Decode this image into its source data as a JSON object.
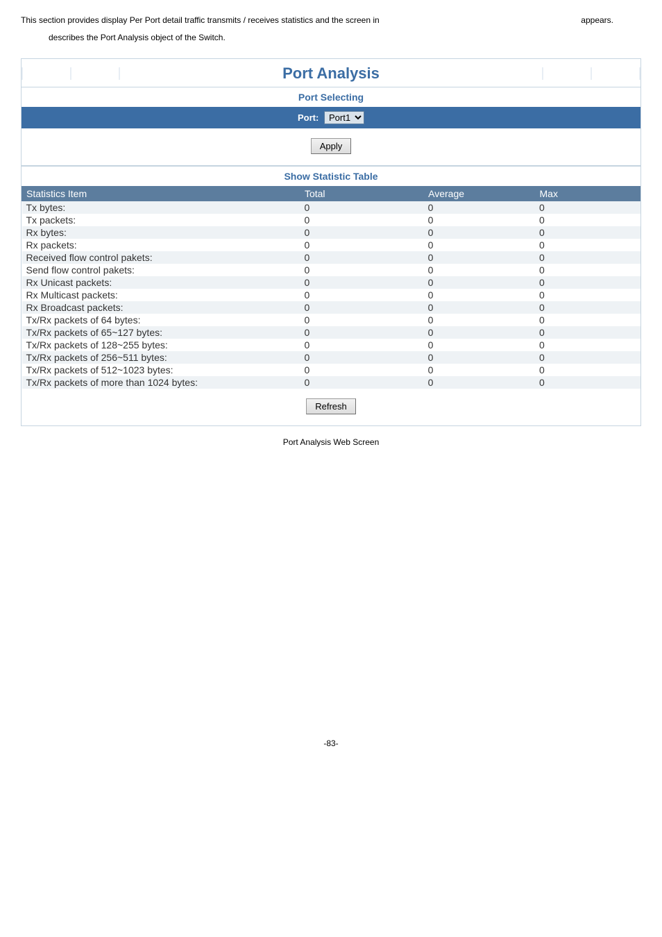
{
  "intro": {
    "line1": "This section provides display Per Port detail traffic transmits / receives statistics and the screen in",
    "appears": "appears.",
    "line2": "describes the Port Analysis object of the Switch."
  },
  "titles": {
    "main": "Port Analysis",
    "port_selecting": "Port Selecting",
    "show_stat": "Show Statistic Table"
  },
  "port": {
    "label": "Port:",
    "selected": "Port1"
  },
  "buttons": {
    "apply": "Apply",
    "refresh": "Refresh"
  },
  "headers": {
    "item": "Statistics Item",
    "total": "Total",
    "avg": "Average",
    "max": "Max"
  },
  "rows": [
    {
      "item": "Tx bytes:",
      "total": "0",
      "avg": "0",
      "max": "0"
    },
    {
      "item": "Tx packets:",
      "total": "0",
      "avg": "0",
      "max": "0"
    },
    {
      "item": "Rx bytes:",
      "total": "0",
      "avg": "0",
      "max": "0"
    },
    {
      "item": "Rx packets:",
      "total": "0",
      "avg": "0",
      "max": "0"
    },
    {
      "item": "Received flow control pakets:",
      "total": "0",
      "avg": "0",
      "max": "0"
    },
    {
      "item": "Send flow control pakets:",
      "total": "0",
      "avg": "0",
      "max": "0"
    },
    {
      "item": "Rx Unicast packets:",
      "total": "0",
      "avg": "0",
      "max": "0"
    },
    {
      "item": "Rx Multicast packets:",
      "total": "0",
      "avg": "0",
      "max": "0"
    },
    {
      "item": "Rx Broadcast packets:",
      "total": "0",
      "avg": "0",
      "max": "0"
    },
    {
      "item": "Tx/Rx packets of 64 bytes:",
      "total": "0",
      "avg": "0",
      "max": "0"
    },
    {
      "item": "Tx/Rx packets of 65~127 bytes:",
      "total": "0",
      "avg": "0",
      "max": "0"
    },
    {
      "item": "Tx/Rx packets of 128~255 bytes:",
      "total": "0",
      "avg": "0",
      "max": "0"
    },
    {
      "item": "Tx/Rx packets of 256~511 bytes:",
      "total": "0",
      "avg": "0",
      "max": "0"
    },
    {
      "item": "Tx/Rx packets of 512~1023 bytes:",
      "total": "0",
      "avg": "0",
      "max": "0"
    },
    {
      "item": "Tx/Rx packets of more than 1024 bytes:",
      "total": "0",
      "avg": "0",
      "max": "0"
    }
  ],
  "caption": "Port Analysis Web Screen",
  "page_number": "-83-"
}
